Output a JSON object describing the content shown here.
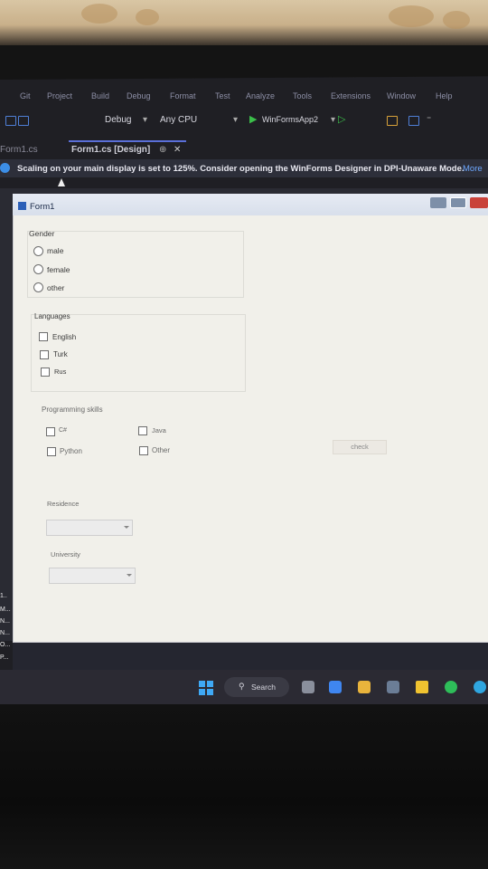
{
  "menubar": {
    "items": [
      "Git",
      "Project",
      "Build",
      "Debug",
      "Format",
      "Test",
      "Analyze",
      "Tools",
      "Extensions",
      "Window",
      "Help"
    ]
  },
  "toolbar": {
    "config": "Debug",
    "platform": "Any CPU",
    "run_target": "WinFormsApp2"
  },
  "tabs": {
    "inactive": "Form1.cs",
    "active": "Form1.cs [Design]",
    "pin": "⊕",
    "close": "✕"
  },
  "infobar": {
    "message": "Scaling on your main display is set to 125%. Consider opening the WinForms Designer in DPI-Unaware Mode.",
    "more": "More"
  },
  "form": {
    "title": "Form1",
    "gender": {
      "title": "Gender",
      "options": [
        "male",
        "female",
        "other"
      ]
    },
    "languages": {
      "title": "Languages",
      "options": [
        "English",
        "Turk",
        "Rus"
      ]
    },
    "programming": {
      "title": "Programming skills",
      "options": [
        "C#",
        "Java",
        "Python",
        "Other"
      ]
    },
    "check_button": "check",
    "residence_label": "Residence",
    "university_label": "University"
  },
  "gutter": [
    "1..",
    "M...",
    "N...",
    "N...",
    "O...",
    "P..."
  ],
  "taskbar": {
    "search": "Search"
  },
  "colors": {
    "accent": "#5a6fd8",
    "info": "#3c8ee6",
    "designer_bg": "#2a2b33",
    "form_bg": "#f1f0ea"
  }
}
